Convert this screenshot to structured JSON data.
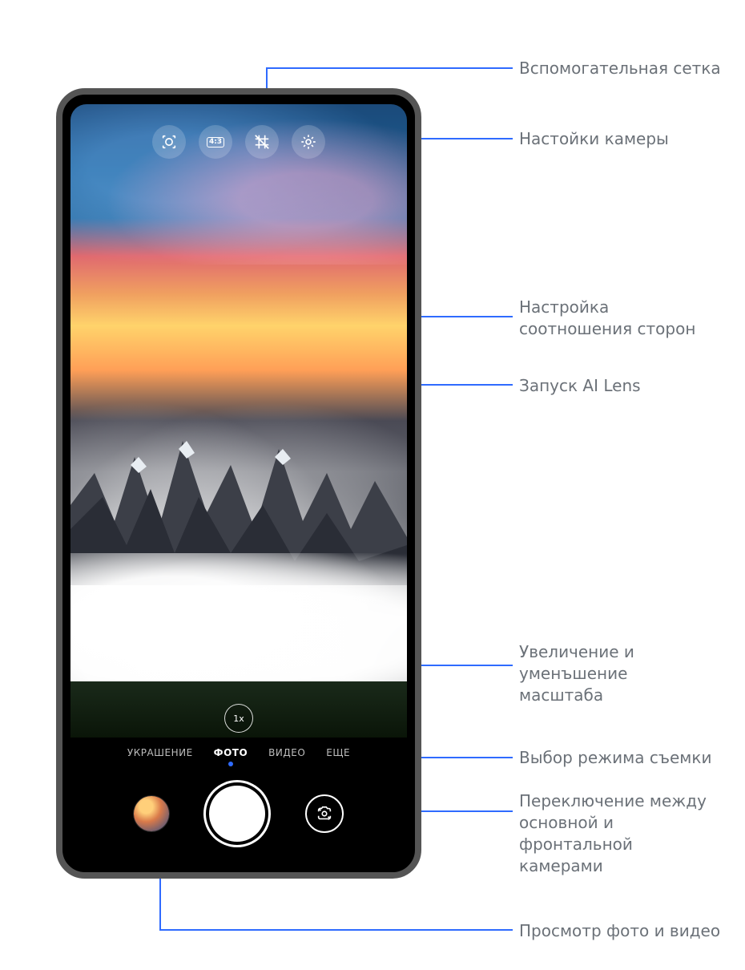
{
  "callouts": {
    "grid": "Вспомогательная сетка",
    "settings": "Настойки камеры",
    "aspect": "Настройка\nсоотношения сторон",
    "ailens": "Запуск AI Lens",
    "zoom": "Увеличение и\nуменъшение\nмасштаба",
    "mode": "Выбор режима съемки",
    "switch": "Переключение между\nосновной и\nфронтальной\nкамерами",
    "gallery": "Просмотр фото и видео"
  },
  "topbar": {
    "ratio_label": "4:3"
  },
  "zoom_label": "1x",
  "modes": {
    "beauty": "УКРАШЕНИЕ",
    "photo": "ФОТО",
    "video": "ВИДЕО",
    "more": "ЕЩЕ"
  },
  "colors": {
    "accent": "#2f6bff"
  }
}
